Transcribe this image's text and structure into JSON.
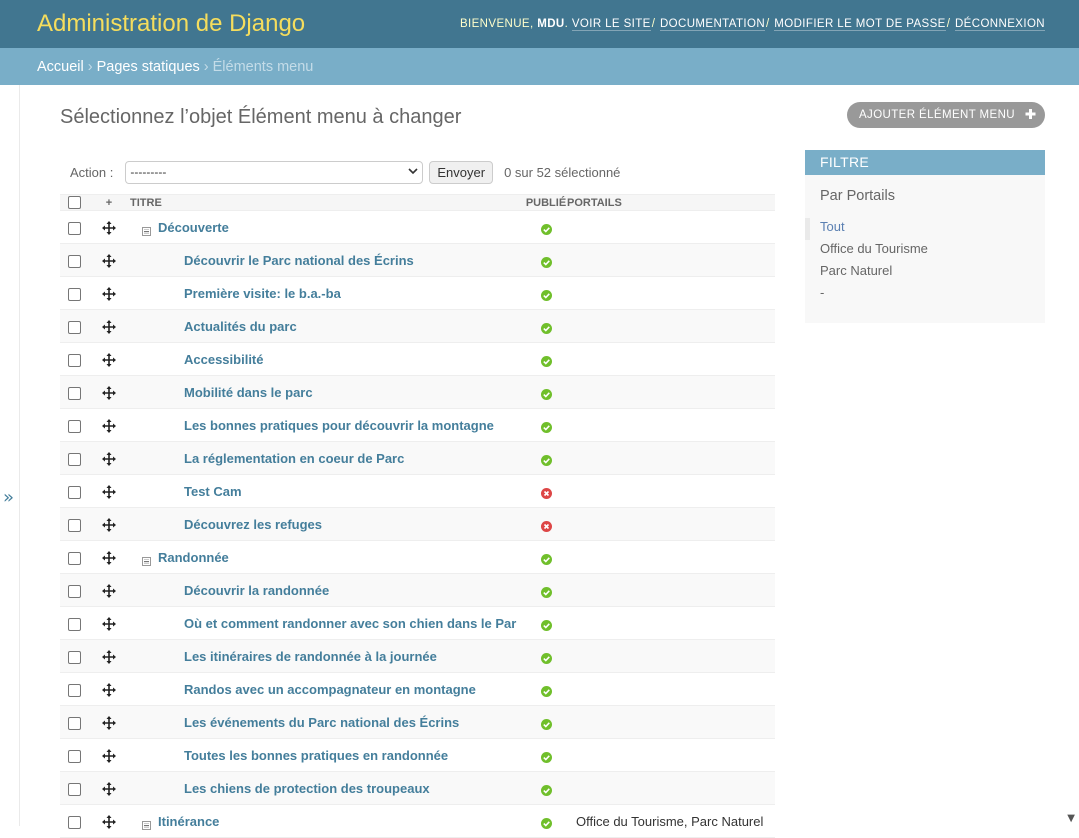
{
  "header": {
    "branding": "Administration de Django",
    "welcome": "Bienvenue,",
    "user": "MDU",
    "links": [
      "Voir le site",
      "Documentation",
      "Modifier le mot de passe",
      "Déconnexion"
    ]
  },
  "breadcrumbs": {
    "items": [
      "Accueil",
      "Pages statiques"
    ],
    "current": "Éléments menu"
  },
  "nav_toggle": "»",
  "page": {
    "title": "Sélectionnez l’objet Élément menu à changer",
    "add_button": "Ajouter Élément menu"
  },
  "actions": {
    "label": "Action :",
    "selected": "---------",
    "go": "Envoyer",
    "counter": "0 sur 52 sélectionné"
  },
  "table": {
    "headers": [
      "+",
      "Titre",
      "Publié",
      "Portails"
    ],
    "rows": [
      {
        "title": "Découverte",
        "level": 0,
        "published": true,
        "portails": ""
      },
      {
        "title": "Découvrir le Parc national des Écrins",
        "level": 1,
        "published": true,
        "portails": ""
      },
      {
        "title": "Première visite: le b.a.-ba",
        "level": 1,
        "published": true,
        "portails": ""
      },
      {
        "title": "Actualités du parc",
        "level": 1,
        "published": true,
        "portails": ""
      },
      {
        "title": "Accessibilité",
        "level": 1,
        "published": true,
        "portails": ""
      },
      {
        "title": "Mobilité dans le parc",
        "level": 1,
        "published": true,
        "portails": ""
      },
      {
        "title": "Les bonnes pratiques pour découvrir la montagne",
        "level": 1,
        "published": true,
        "portails": ""
      },
      {
        "title": "La réglementation en coeur de Parc",
        "level": 1,
        "published": true,
        "portails": ""
      },
      {
        "title": "Test Cam",
        "level": 1,
        "published": false,
        "portails": ""
      },
      {
        "title": "Découvrez les refuges",
        "level": 1,
        "published": false,
        "portails": ""
      },
      {
        "title": "Randonnée",
        "level": 0,
        "published": true,
        "portails": ""
      },
      {
        "title": "Découvrir la randonnée",
        "level": 1,
        "published": true,
        "portails": ""
      },
      {
        "title": "Où et comment randonner avec son chien dans le Par",
        "level": 1,
        "published": true,
        "portails": ""
      },
      {
        "title": "Les itinéraires de randonnée à la journée",
        "level": 1,
        "published": true,
        "portails": ""
      },
      {
        "title": "Randos avec un accompagnateur en montagne",
        "level": 1,
        "published": true,
        "portails": ""
      },
      {
        "title": "Les événements du Parc national des Écrins",
        "level": 1,
        "published": true,
        "portails": ""
      },
      {
        "title": "Toutes les bonnes pratiques en randonnée",
        "level": 1,
        "published": true,
        "portails": ""
      },
      {
        "title": "Les chiens de protection des troupeaux",
        "level": 1,
        "published": true,
        "portails": ""
      },
      {
        "title": "Itinérance",
        "level": 0,
        "published": true,
        "portails": "Office du Tourisme, Parc Naturel"
      }
    ]
  },
  "filter": {
    "heading": "Filtre",
    "group": "Par Portails",
    "options": [
      "Tout",
      "Office du Tourisme",
      "Parc Naturel",
      "-"
    ],
    "selected_index": 0
  },
  "colors": {
    "header_bg": "#417690",
    "branding": "#f5dd5d",
    "breadcrumbs_bg": "#79aec8",
    "link": "#447e9b",
    "published_yes": "#70bf2b",
    "published_no": "#dd4646"
  }
}
